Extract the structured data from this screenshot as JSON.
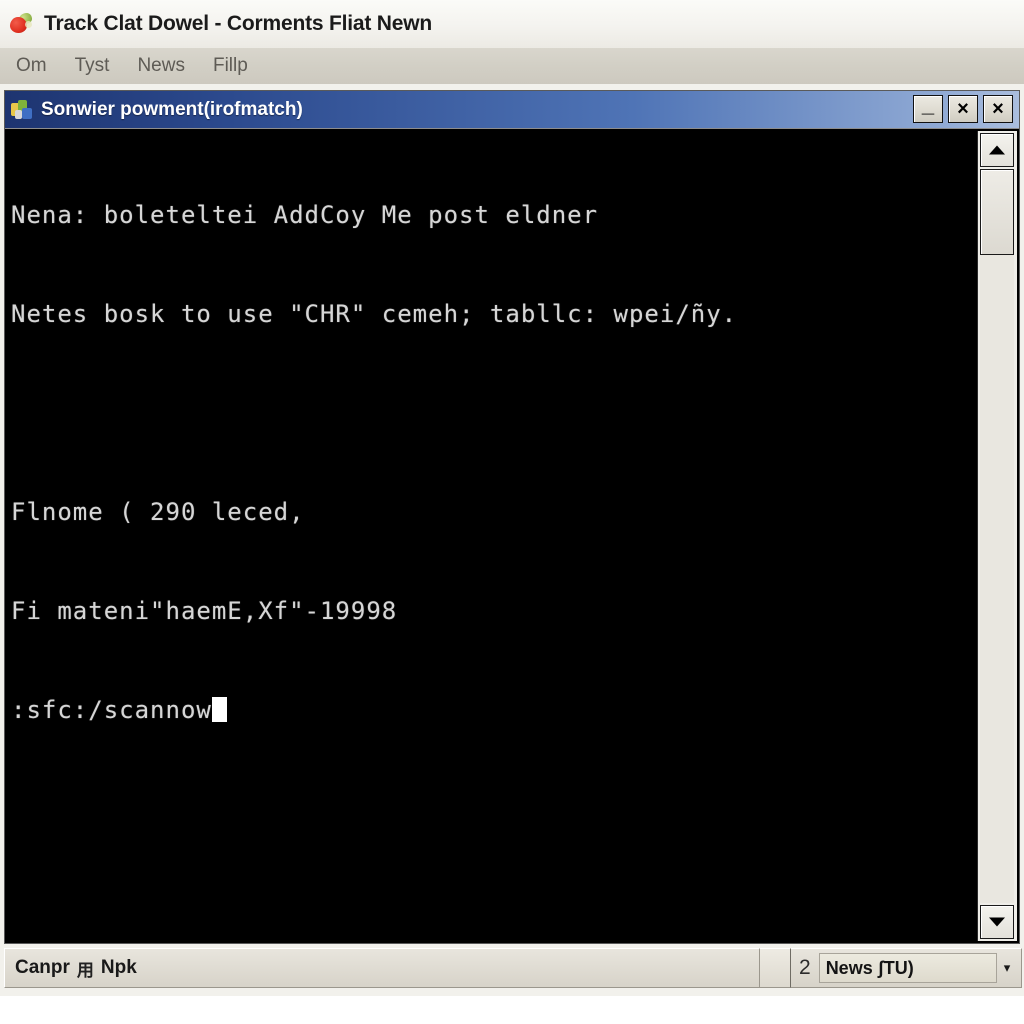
{
  "outer_window": {
    "title": "Track Clat Dowel - Corments Fliat Newn",
    "icon": "berry-icon",
    "menu": [
      {
        "label": "Om"
      },
      {
        "label": "Tyst"
      },
      {
        "label": "News"
      },
      {
        "label": "Fillp"
      }
    ]
  },
  "console_window": {
    "title": "Sonwier powment(irofmatch)",
    "icon": "windows-console-icon",
    "titlebar_color_left": "#1d3470",
    "titlebar_color_right": "#aabede",
    "buttons": [
      {
        "name": "minimize-button",
        "glyph": "_"
      },
      {
        "name": "close-button-1",
        "glyph": "×"
      },
      {
        "name": "close-button-2",
        "glyph": "×"
      }
    ],
    "background_color": "#000000",
    "text_color": "#d6d6d6",
    "lines": [
      "Nena: boleteltei AddCoy Me post eldner",
      "Netes bosk to use \"CHR\" cemeh; tabllc: wpei/ñy.",
      "",
      "Flnome ( 290 leced,",
      "Fi mateni\"haemE,Xf\"-19998",
      ":sfc:/scannow"
    ],
    "cursor": "block-cursor",
    "scrollbar": {
      "up_arrow": "scroll-up-arrow",
      "down_arrow": "scroll-down-arrow",
      "thumb": "scroll-thumb"
    }
  },
  "statusbar": {
    "left_text": "Canpr",
    "left_glyph": "用",
    "left_text_2": "Npk",
    "count": "2",
    "combo_value": "News ʃTU)",
    "chevron": "▾"
  }
}
